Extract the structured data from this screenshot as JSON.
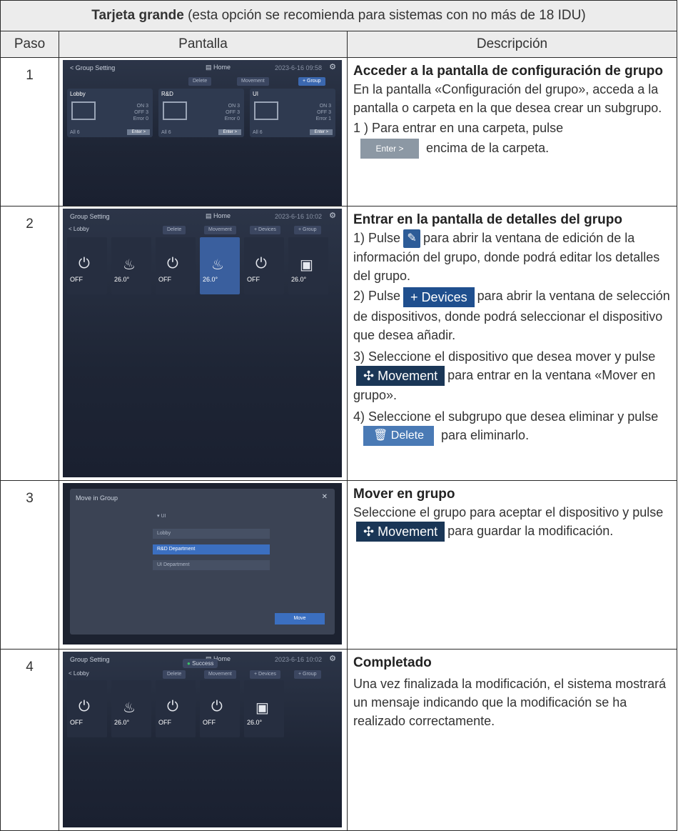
{
  "title": {
    "bold": "Tarjeta grande",
    "rest": " (esta opción se recomienda para sistemas con no más de 18 IDU)"
  },
  "headers": [
    "Paso",
    "Pantalla",
    "Descripción"
  ],
  "steps": [
    {
      "num": "1",
      "heading": "Acceder a la pantalla de configuración de grupo",
      "text1": "En la pantalla «Configuración del grupo», acceda a la pantalla o carpeta en la que desea crear un subgrupo.",
      "text2": "1 ) Para entrar en una carpeta, pulse",
      "button": "Enter >",
      "text3": "encima de la carpeta.",
      "screen": {
        "title": "< Group Setting",
        "home": "Home",
        "time": "2023-6-16 09:58",
        "buttons": [
          "Delete",
          "Movement",
          "+ Group"
        ],
        "folders": [
          {
            "name": "Lobby",
            "status": [
              "ON 3",
              "OFF 3",
              "Error 0"
            ],
            "all": "All 6",
            "enter": "Enter >"
          },
          {
            "name": "R&D",
            "status": [
              "ON 3",
              "OFF 3",
              "Error 0"
            ],
            "all": "All 6",
            "enter": "Enter >"
          },
          {
            "name": "UI",
            "status": [
              "ON 3",
              "OFF 3",
              "Error 1"
            ],
            "all": "All 6",
            "enter": "Enter >"
          }
        ]
      }
    },
    {
      "num": "2",
      "heading": "Entrar en la pantalla de detalles del grupo",
      "p1a": "1) Pulse",
      "p1b": "para abrir la ventana de edición de la información del grupo, donde podrá editar los detalles del grupo.",
      "p2a": "2) Pulse",
      "btn_devices": "+ Devices",
      "p2b": "para abrir la ventana de selección de dispositivos, donde podrá seleccionar el dispositivo que desea añadir.",
      "p3a": "3) Seleccione el dispositivo que desea mover y pulse",
      "btn_movement": "✣ Movement",
      "p3b": "para entrar en la ventana «Mover en grupo».",
      "p4a": "4) Seleccione el subgrupo que desea eliminar y pulse",
      "btn_delete": "Delete",
      "p4b": "para eliminarlo.",
      "screen": {
        "title": "Group Setting",
        "home": "Home",
        "time": "2023-6-16 10:02",
        "back": "< Lobby",
        "buttons": [
          "Delete",
          "Movement",
          "+ Devices",
          "+ Group"
        ],
        "cards": [
          "OFF",
          "26.0°",
          "OFF",
          "26.0°",
          "OFF",
          "26.0°"
        ]
      }
    },
    {
      "num": "3",
      "heading": "Mover en grupo",
      "text1": "Seleccione el grupo para aceptar el dispositivo y pulse",
      "btn_movement": "✣ Movement",
      "text2": "para guardar la modificación.",
      "screen": {
        "title": "Move in Group",
        "rows": [
          "UI",
          "Lobby",
          "R&D Department",
          "UI Department"
        ],
        "button": "Move"
      }
    },
    {
      "num": "4",
      "heading": "Completado",
      "text1": "Una vez finalizada la modificación, el sistema mostrará un mensaje indicando que la modificación se ha realizado correctamente.",
      "screen": {
        "title": "Group Setting",
        "home": "Home",
        "time": "2023-6-16 10:02",
        "toast": "Success",
        "back": "< Lobby",
        "buttons": [
          "Delete",
          "Movement",
          "+ Devices",
          "+ Group"
        ],
        "cards": [
          "OFF",
          "26.0°",
          "OFF",
          "OFF",
          "26.0°"
        ]
      }
    }
  ]
}
